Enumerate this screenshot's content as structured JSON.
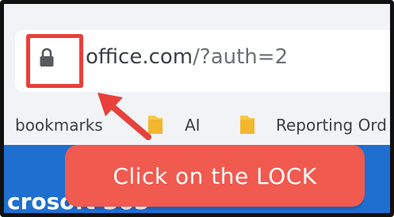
{
  "browser": {
    "url_domain": "office.com",
    "url_rest": "/?auth=2",
    "lock_icon": "lock-icon"
  },
  "bookmarks": {
    "items": [
      {
        "label": "bookmarks"
      },
      {
        "label": "AI",
        "icon": "folder-icon"
      },
      {
        "label": "Reporting Ord",
        "icon": "folder-icon"
      }
    ]
  },
  "page": {
    "partial_title": "crosoft 365"
  },
  "annotation": {
    "callout_text": "Click on the LOCK",
    "highlight_color": "#e8403b",
    "callout_color": "#f05a4f"
  }
}
